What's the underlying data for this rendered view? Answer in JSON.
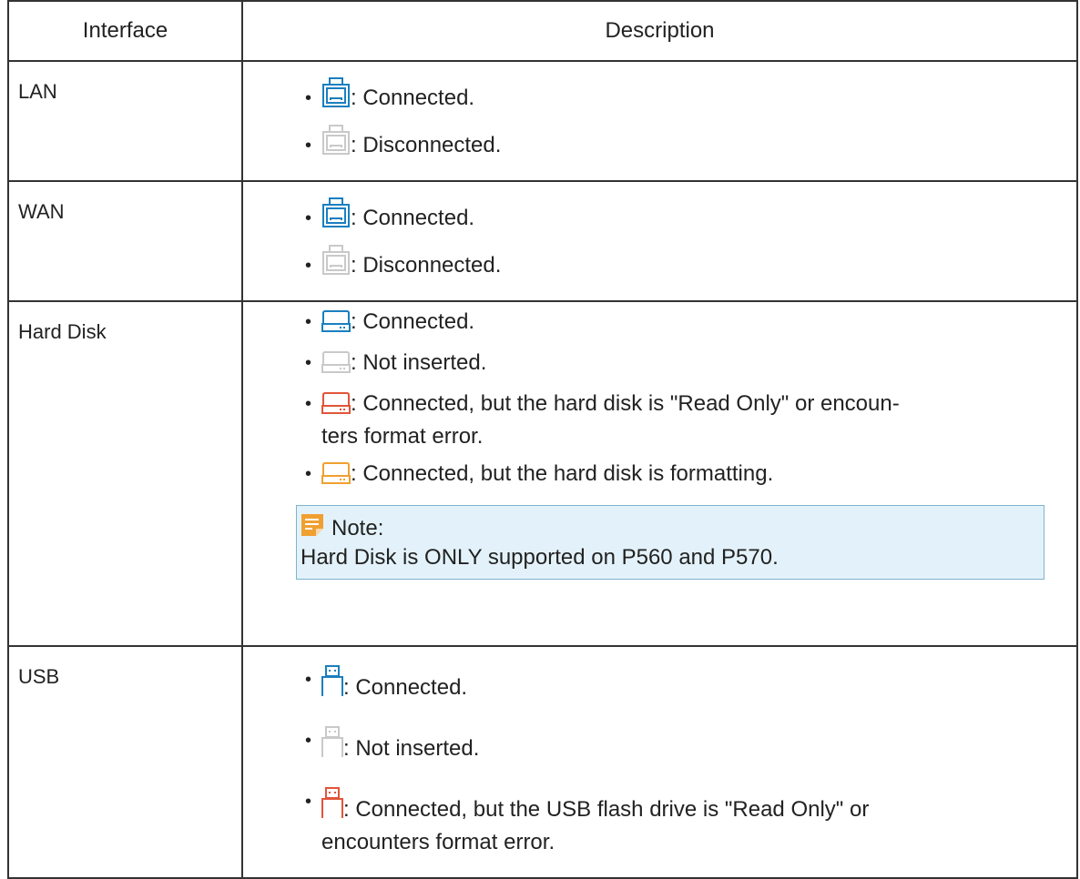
{
  "table": {
    "headers": [
      "Interface",
      "Description"
    ],
    "rows": [
      {
        "name": "LAN",
        "items": [
          {
            "icon": "lan-port-icon",
            "color": "#1a7fbf",
            "text": ": Connected."
          },
          {
            "icon": "lan-port-icon",
            "color": "#c9c9c9",
            "text": ": Disconnected."
          }
        ]
      },
      {
        "name": "WAN",
        "items": [
          {
            "icon": "wan-port-icon",
            "color": "#1a7fbf",
            "text": ": Connected."
          },
          {
            "icon": "wan-port-icon",
            "color": "#c9c9c9",
            "text": ": Disconnected."
          }
        ]
      },
      {
        "name": "Hard Disk",
        "items": [
          {
            "icon": "hard-disk-icon",
            "color": "#1a7fbf",
            "text": ": Connected."
          },
          {
            "icon": "hard-disk-icon",
            "color": "#c9c9c9",
            "text": ": Not inserted."
          },
          {
            "icon": "hard-disk-icon",
            "color": "#e0553a",
            "text": ": Connected, but the hard disk is \"Read Only\" or encoun-",
            "text2": "ters format error."
          },
          {
            "icon": "hard-disk-icon",
            "color": "#f0a030",
            "text": ": Connected, but the hard disk is formatting."
          }
        ],
        "note": {
          "title": "Note:",
          "body": "Hard Disk is ONLY supported on P560 and P570.",
          "icon": "note-icon",
          "icon_color": "#f0a030"
        }
      },
      {
        "name": "USB",
        "items": [
          {
            "icon": "usb-icon",
            "color": "#1a7fbf",
            "text": ": Connected."
          },
          {
            "icon": "usb-icon",
            "color": "#c9c9c9",
            "text": ": Not inserted."
          },
          {
            "icon": "usb-icon",
            "color": "#e0553a",
            "text": ": Connected, but the USB flash drive is \"Read Only\" or",
            "text2": "encounters format error."
          }
        ]
      }
    ]
  }
}
